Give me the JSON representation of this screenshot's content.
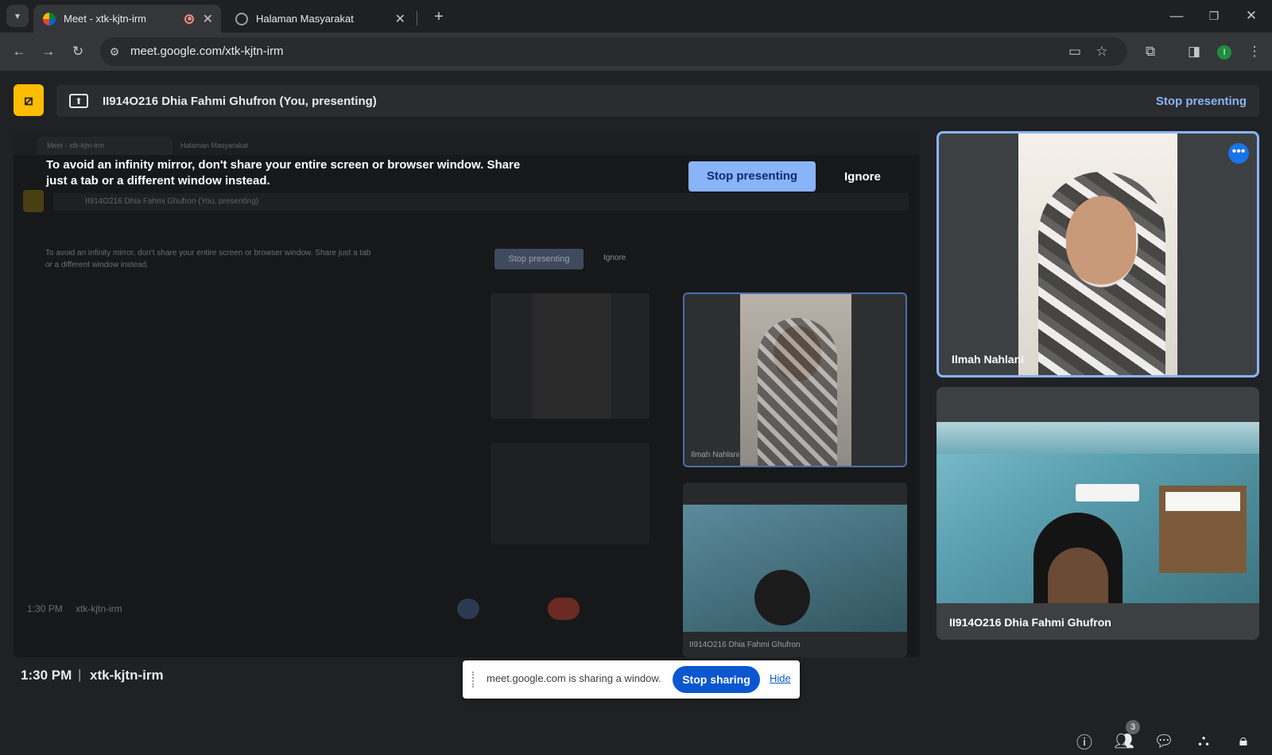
{
  "browser": {
    "tabs": [
      {
        "title": "Meet - xtk-kjtn-irm",
        "active": true
      },
      {
        "title": "Halaman Masyarakat",
        "active": false
      }
    ],
    "url": "meet.google.com/xtk-kjtn-irm",
    "profile_initial": "I"
  },
  "presenting_bar": {
    "label": "II914O216 Dhia Fahmi Ghufron (You, presenting)",
    "stop_label": "Stop presenting"
  },
  "mirror_warning": {
    "text": "To avoid an infinity mirror, don't share your entire screen or browser window. Share just a tab or a different window instead.",
    "stop_label": "Stop presenting",
    "ignore_label": "Ignore"
  },
  "participants": [
    {
      "name": "Ilmah Nahlani",
      "pinned": true
    },
    {
      "name": "II914O216 Dhia Fahmi Ghufron",
      "pinned": false
    }
  ],
  "footer": {
    "time": "1:30 PM",
    "separator": "|",
    "meeting_code": "xtk-kjtn-irm",
    "people_count": "3"
  },
  "share_notice": {
    "text": "meet.google.com is sharing a window.",
    "stop_label": "Stop sharing",
    "hide_label": "Hide"
  },
  "colors": {
    "accent": "#8ab4f8",
    "primary_button": "#0b57d0",
    "hangup": "#ea4335",
    "present_yellow": "#fbbc04"
  }
}
